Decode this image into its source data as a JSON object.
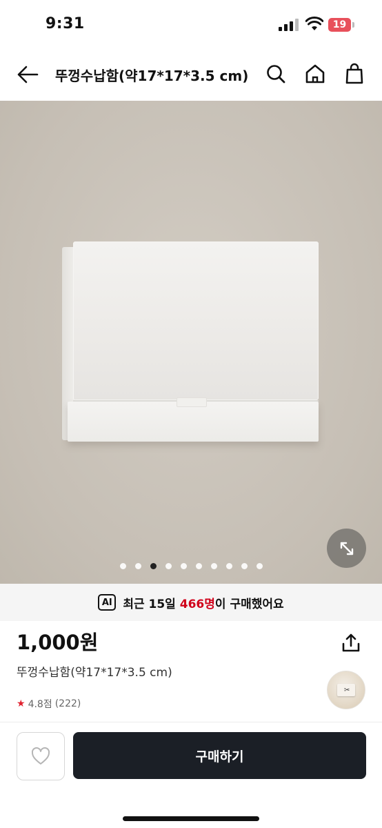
{
  "status_bar": {
    "time": "9:31",
    "battery": "19",
    "battery_level_percent": 19,
    "battery_color": "#e8505b",
    "icons": [
      "signal-icon",
      "wifi-icon",
      "battery-icon"
    ]
  },
  "header": {
    "title": "뚜껑수납함(약17*17*3.5 cm)",
    "icons": [
      "back-arrow-icon",
      "search-icon",
      "home-icon",
      "shopping-bag-icon"
    ]
  },
  "gallery": {
    "image_count": 10,
    "active_index": 2,
    "expand_icon": "expand-arrows-icon"
  },
  "ai_banner": {
    "badge": "AI",
    "prefix": "최근 15일 ",
    "count": "466명",
    "suffix": "이 구매했어요",
    "highlight_color": "#d0021b"
  },
  "product": {
    "price": "1,000원",
    "name": "뚜껑수납함(약17*17*3.5 cm)",
    "rating": "4.8점",
    "review_count": "(222)",
    "share_icon": "share-icon"
  },
  "bottom_bar": {
    "buy_label": "구매하기",
    "wish_icon": "heart-icon",
    "buy_button_color": "#1b1f26"
  }
}
